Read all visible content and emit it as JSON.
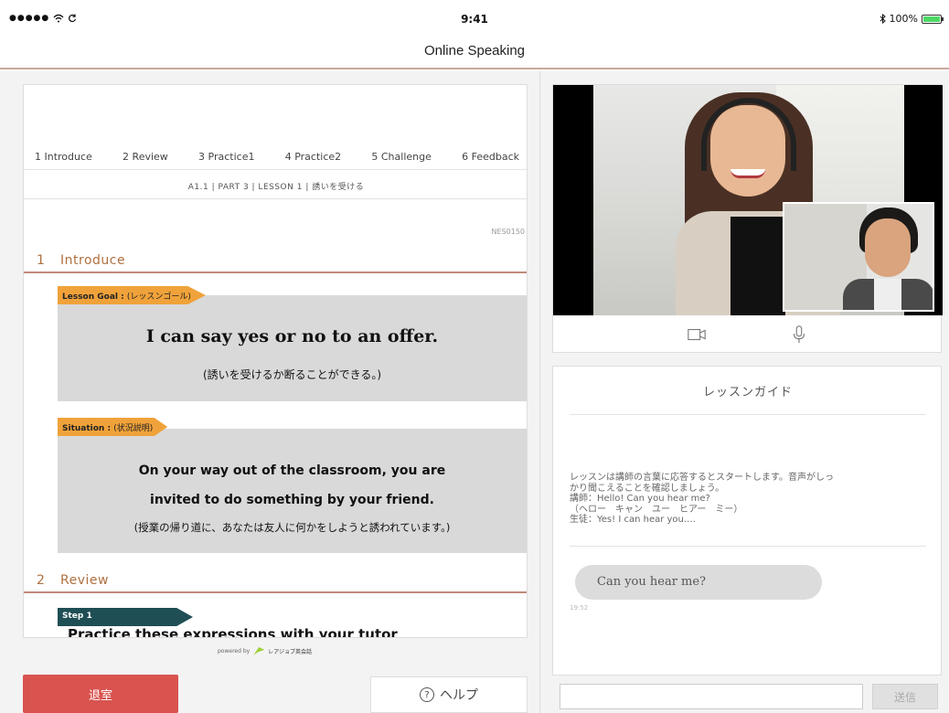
{
  "status_bar": {
    "signal_dots": "●●●●●",
    "time": "9:41",
    "battery_text": "100%",
    "battery_level": 1.0
  },
  "nav": {
    "title": "Online Speaking"
  },
  "lesson": {
    "tabs": [
      {
        "label": "1 Introduce"
      },
      {
        "label": "2 Review"
      },
      {
        "label": "3 Practice1"
      },
      {
        "label": "4 Practice2"
      },
      {
        "label": "5 Challenge"
      },
      {
        "label": "6 Feedback"
      }
    ],
    "breadcrumb": "A1.1 | PART 3 | LESSON 1 | 誘いを受ける",
    "code": "NES0150",
    "sections": [
      {
        "num": "1",
        "title": "Introduce"
      },
      {
        "num": "2",
        "title": "Review"
      }
    ],
    "goal": {
      "tag": "Lesson Goal :",
      "tag_sub": "(レッスンゴール)",
      "en": "I can say yes or no to an offer.",
      "ja": "(誘いを受けるか断ることができる。)"
    },
    "situation": {
      "tag": "Situation :",
      "tag_sub": "(状況説明)",
      "en_line1": "On your way out of the classroom, you are",
      "en_line2": "invited to do something by your friend.",
      "ja": "(授業の帰り道に、あなたは友人に何かをしようと誘われています。)"
    },
    "step": {
      "tag": "Step 1",
      "text": "Practice these expressions with your tutor"
    },
    "powered_by": "powered by",
    "logo_text": "レアジョブ英会話"
  },
  "buttons": {
    "exit": "退室",
    "help": "ヘルプ"
  },
  "guide": {
    "title": "レッスンガイド",
    "lines": [
      "レッスンは講師の言葉に応答するとスタートします。音声がしっ",
      "かり聞こえることを確認しましょう。",
      "講師：Hello! Can you hear me?",
      "（ヘロー　キャン　ユー　ヒアー　ミー）",
      "生徒：Yes! I can hear you.…"
    ],
    "chat_message": "Can you hear me?",
    "chat_time": "19:52"
  },
  "chat_input": {
    "value": "",
    "placeholder": "",
    "send_label": "送信"
  },
  "colors": {
    "accent_orange": "#f0a23a",
    "section_brown": "#b0703f",
    "exit_red": "#d9534f",
    "step_teal": "#1f4e55"
  }
}
